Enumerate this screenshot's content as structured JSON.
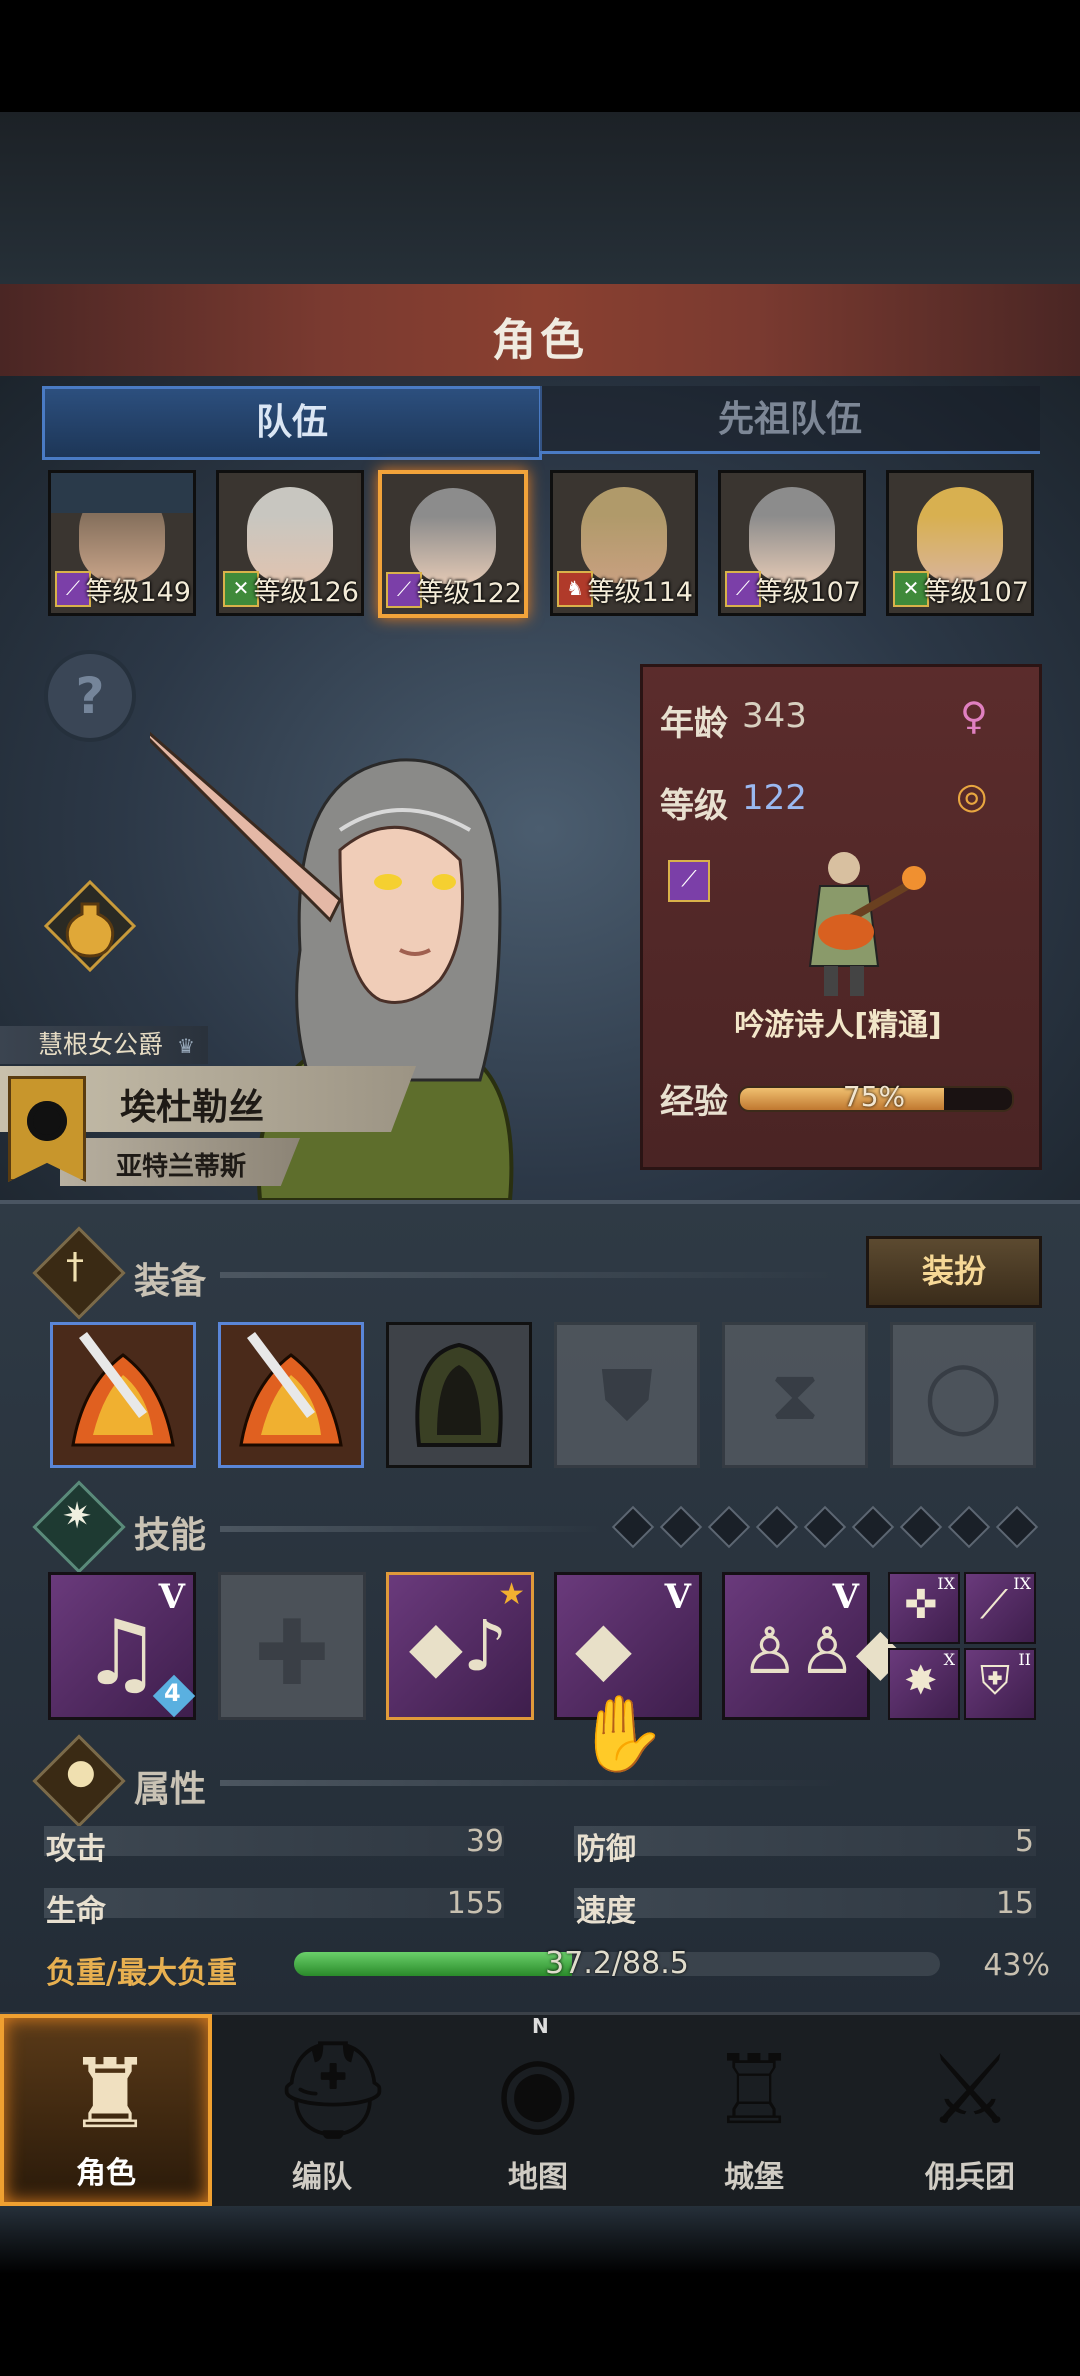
{
  "screen": {
    "title": "角色"
  },
  "tabs": [
    {
      "label": "队伍",
      "active": true
    },
    {
      "label": "先祖队伍",
      "active": false
    }
  ],
  "heroes": [
    {
      "level_text": "等级149",
      "class_icon": "staff-icon",
      "class_color": "#7b3fa8",
      "selected": false
    },
    {
      "level_text": "等级126",
      "class_icon": "crossbow-icon",
      "class_color": "#3f8a3a",
      "selected": false
    },
    {
      "level_text": "等级122",
      "class_icon": "staff-icon",
      "class_color": "#7b3fa8",
      "selected": true
    },
    {
      "level_text": "等级114",
      "class_icon": "horse-icon",
      "class_color": "#b03a2a",
      "selected": false
    },
    {
      "level_text": "等级107",
      "class_icon": "staff-icon",
      "class_color": "#7b3fa8",
      "selected": false
    },
    {
      "level_text": "等级107",
      "class_icon": "crossbow-icon",
      "class_color": "#3f8a3a",
      "selected": false
    }
  ],
  "character": {
    "title": "慧根女公爵",
    "name": "埃杜勒丝",
    "region": "亚特兰蒂斯",
    "age_label": "年龄",
    "age": "343",
    "level_label": "等级",
    "level": "122",
    "class_name": "吟游诗人[精通]",
    "xp_label": "经验",
    "xp_text": "75%",
    "xp_fraction": 0.75
  },
  "equipment": {
    "title": "装备",
    "outfit_button": "装扮",
    "slots": [
      {
        "name": "flame-weapon-icon",
        "filled": true
      },
      {
        "name": "flame-weapon-icon",
        "filled": true
      },
      {
        "name": "hood-icon",
        "filled": true
      },
      {
        "name": "armor-icon",
        "filled": false
      },
      {
        "name": "boots-icon",
        "filled": false
      },
      {
        "name": "ring-icon",
        "filled": false
      }
    ]
  },
  "skills": {
    "title": "技能",
    "slots": [
      {
        "name": "music-note-skill-icon",
        "rank": "V",
        "badge": "4"
      },
      {
        "name": "empty-skill-slot-icon",
        "rank": "",
        "badge": ""
      },
      {
        "name": "crystal-note-skill-icon",
        "rank": "",
        "badge": ""
      },
      {
        "name": "crystal-hand-skill-icon",
        "rank": "V",
        "badge": ""
      },
      {
        "name": "crowd-crystal-skill-icon",
        "rank": "V",
        "badge": ""
      }
    ],
    "mini": [
      {
        "name": "target-skill-icon",
        "rank": "IX"
      },
      {
        "name": "spear-skill-icon",
        "rank": "IX"
      },
      {
        "name": "burst-skill-icon",
        "rank": "X"
      },
      {
        "name": "shield-skill-icon",
        "rank": "II"
      }
    ]
  },
  "attributes": {
    "title": "属性",
    "attack_label": "攻击",
    "attack": "39",
    "defense_label": "防御",
    "defense": "5",
    "hp_label": "生命",
    "hp": "155",
    "speed_label": "速度",
    "speed": "15",
    "load_label": "负重/最大负重",
    "load": "37.2/88.5",
    "load_pct": "43%",
    "load_fraction": 0.43
  },
  "nav": [
    {
      "label": "角色",
      "active": true,
      "icon": "knight-icon"
    },
    {
      "label": "编队",
      "active": false,
      "icon": "helmet-icon"
    },
    {
      "label": "地图",
      "active": false,
      "icon": "compass-map-icon"
    },
    {
      "label": "城堡",
      "active": false,
      "icon": "castle-icon"
    },
    {
      "label": "佣兵团",
      "active": false,
      "icon": "mercenary-icon"
    }
  ],
  "colors": {
    "accent": "#f2a33a",
    "tab_active": "#2c4f7e",
    "panel": "#5b2c2c",
    "skill": "#6a3a7c"
  },
  "compass_letter": "N"
}
